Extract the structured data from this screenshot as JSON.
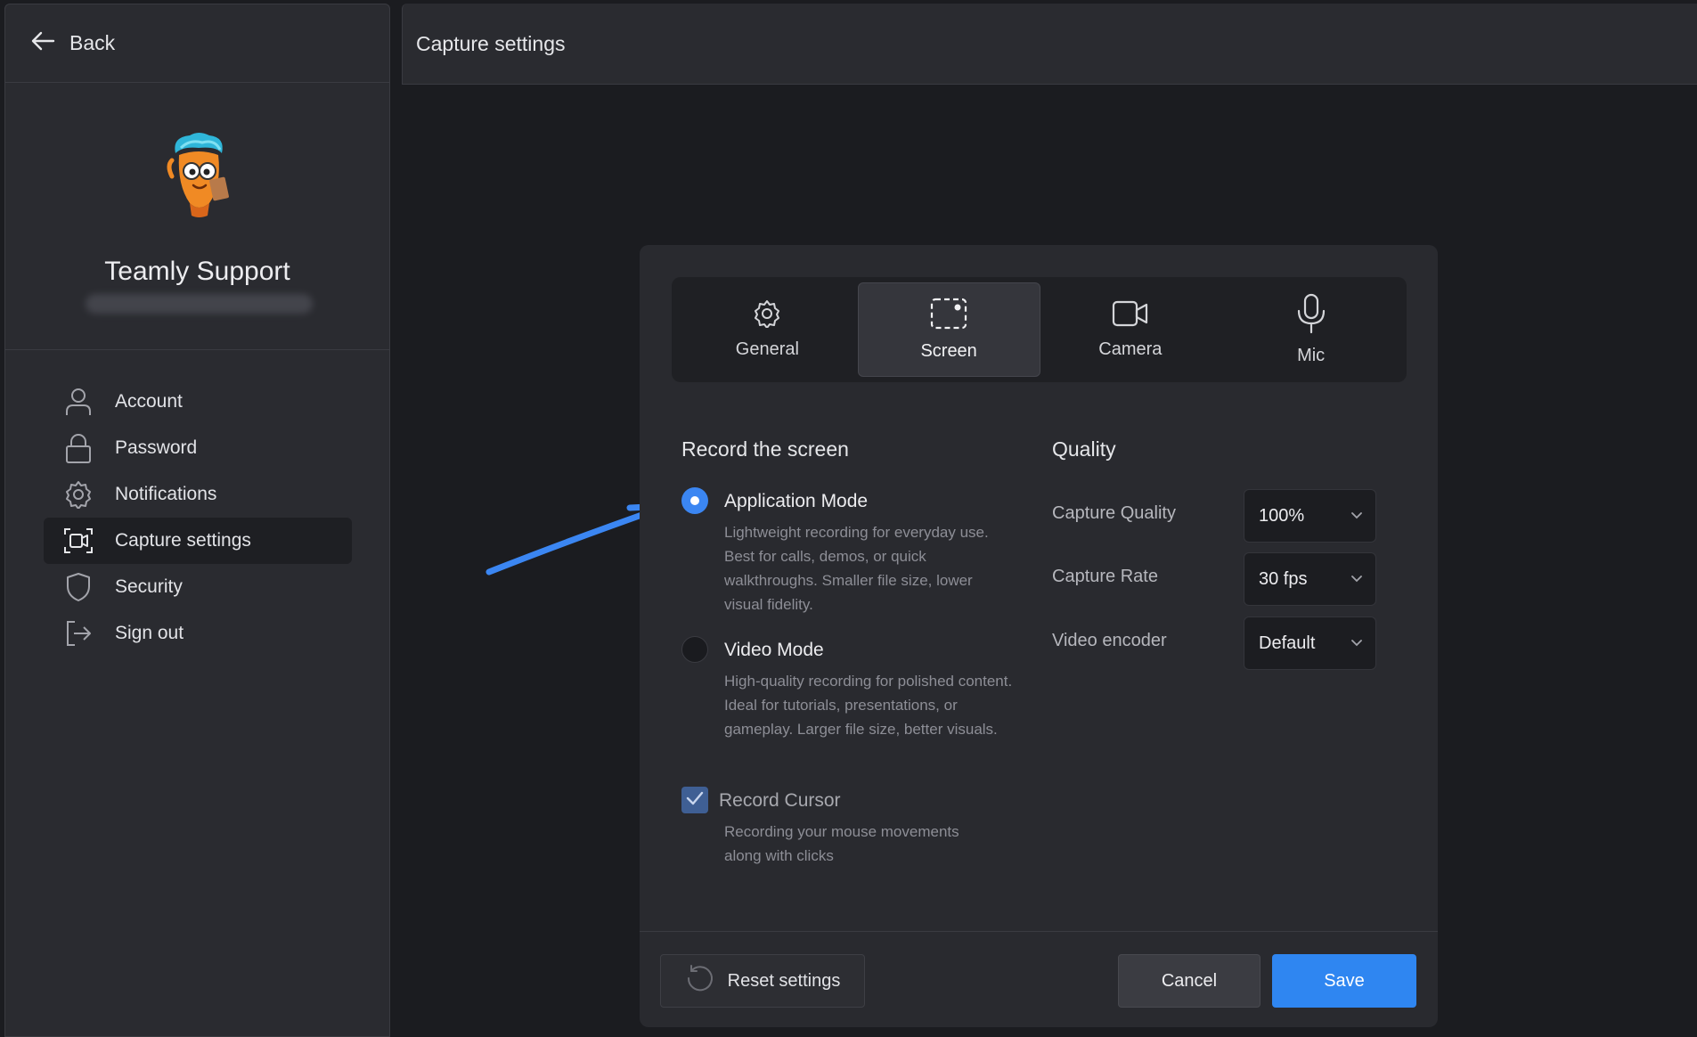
{
  "back": {
    "label": "Back"
  },
  "profile": {
    "name": "Teamly Support"
  },
  "nav": [
    {
      "label": "Account",
      "icon": "user-icon"
    },
    {
      "label": "Password",
      "icon": "lock-icon"
    },
    {
      "label": "Notifications",
      "icon": "gear-icon"
    },
    {
      "label": "Capture settings",
      "icon": "capture-icon",
      "active": true
    },
    {
      "label": "Security",
      "icon": "shield-icon"
    },
    {
      "label": "Sign out",
      "icon": "sign-out-icon"
    }
  ],
  "header": {
    "title": "Capture settings"
  },
  "tabs": [
    {
      "label": "General",
      "icon": "gear-icon"
    },
    {
      "label": "Screen",
      "icon": "screen-capture-icon",
      "active": true
    },
    {
      "label": "Camera",
      "icon": "camera-icon"
    },
    {
      "label": "Mic",
      "icon": "mic-icon"
    }
  ],
  "record": {
    "title": "Record the screen",
    "application_mode": {
      "title": "Application Mode",
      "description": "Lightweight recording for everyday use. Best for calls, demos, or quick walkthroughs. Smaller file size, lower visual fidelity.",
      "selected": true
    },
    "video_mode": {
      "title": "Video Mode",
      "description": "High-quality recording for polished content. Ideal for tutorials, presentations, or gameplay. Larger file size, better visuals.",
      "selected": false
    },
    "record_cursor": {
      "label": "Record Cursor",
      "description": "Recording your mouse movements along with clicks",
      "checked": true
    }
  },
  "quality": {
    "title": "Quality",
    "capture_quality": {
      "label": "Capture Quality",
      "value": "100%"
    },
    "capture_rate": {
      "label": "Capture Rate",
      "value": "30 fps"
    },
    "video_encoder": {
      "label": "Video encoder",
      "value": "Default"
    }
  },
  "footer": {
    "reset_label": "Reset settings",
    "cancel_label": "Cancel",
    "save_label": "Save"
  },
  "colors": {
    "accent": "#2f86f1",
    "background": "#1b1c20",
    "panel": "#2a2b30",
    "arrow": "#3b86f2"
  }
}
